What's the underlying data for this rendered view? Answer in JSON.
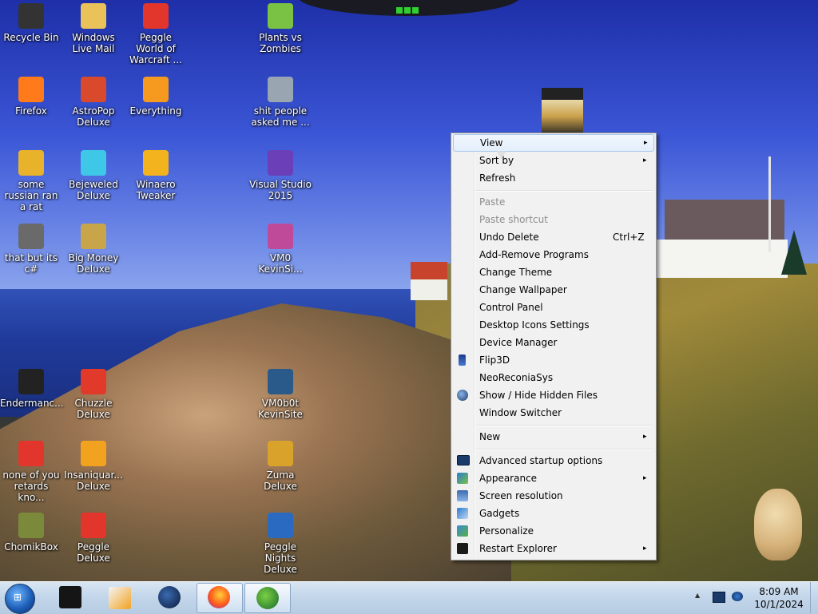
{
  "desktop_icons": [
    {
      "label": "Recycle Bin",
      "icon": "recycle-bin-icon",
      "color": "#333333"
    },
    {
      "label": "Windows Live Mail",
      "icon": "mail-icon",
      "color": "#e9c25a"
    },
    {
      "label": "Peggle World of Warcraft ...",
      "icon": "peggle-icon",
      "color": "#e2352b"
    },
    {
      "label": "Plants vs Zombies",
      "icon": "plants-icon",
      "color": "#7ac244"
    },
    {
      "label": "Firefox",
      "icon": "firefox-icon",
      "color": "#ff7a1a"
    },
    {
      "label": "AstroPop Deluxe",
      "icon": "astropop-icon",
      "color": "#d94a2c"
    },
    {
      "label": "Everything",
      "icon": "magnifier-icon",
      "color": "#f59a1e"
    },
    {
      "label": "shit people asked me ...",
      "icon": "file-icon",
      "color": "#9aa5b2"
    },
    {
      "label": "some russian ran a rat",
      "icon": "de-icon",
      "color": "#e8b22a"
    },
    {
      "label": "Bejeweled Deluxe",
      "icon": "gem-icon",
      "color": "#3fc7e8"
    },
    {
      "label": "Winaero Tweaker",
      "icon": "winaero-icon",
      "color": "#f2b31e"
    },
    {
      "label": "Visual Studio 2015",
      "icon": "visual-studio-icon",
      "color": "#6a3fb8"
    },
    {
      "label": "that but its c#",
      "icon": "stack-icon",
      "color": "#6a6a6a"
    },
    {
      "label": "Big Money Deluxe",
      "icon": "money-bag-icon",
      "color": "#c9a54a"
    },
    {
      "label": "VM0 KevinSi...",
      "icon": "vm-icon",
      "color": "#c04a9a"
    },
    {
      "label": "Endermanc...",
      "icon": "terminal-icon",
      "color": "#222222"
    },
    {
      "label": "Chuzzle Deluxe",
      "icon": "chuzzle-icon",
      "color": "#e23a2a"
    },
    {
      "label": "VM0b0t KevinSite",
      "icon": "vm-bot-icon",
      "color": "#2a5a8a"
    },
    {
      "label": "none of you retards kno...",
      "icon": "red-app-icon",
      "color": "#e2352b"
    },
    {
      "label": "Insaniquar... Deluxe",
      "icon": "insaniquarium-icon",
      "color": "#f2a21e"
    },
    {
      "label": "Zuma Deluxe",
      "icon": "zuma-icon",
      "color": "#d9a22a"
    },
    {
      "label": "ChomikBox",
      "icon": "chomik-icon",
      "color": "#7a8a3a"
    },
    {
      "label": "Peggle Deluxe",
      "icon": "peggle-icon",
      "color": "#e2352b"
    },
    {
      "label": "Peggle Nights Deluxe",
      "icon": "peggle-nights-icon",
      "color": "#2a6ac0"
    }
  ],
  "context_menu": {
    "view": "View",
    "sort_by": "Sort by",
    "refresh": "Refresh",
    "paste": "Paste",
    "paste_shortcut": "Paste shortcut",
    "undo_delete": "Undo Delete",
    "undo_delete_shortcut": "Ctrl+Z",
    "add_remove_programs": "Add-Remove Programs",
    "change_theme": "Change Theme",
    "change_wallpaper": "Change Wallpaper",
    "control_panel": "Control Panel",
    "desktop_icons_settings": "Desktop Icons Settings",
    "device_manager": "Device Manager",
    "flip3d": "Flip3D",
    "neoreconiasys": "NeoReconiaSys",
    "show_hide_hidden_files": "Show / Hide Hidden Files",
    "window_switcher": "Window Switcher",
    "new": "New",
    "advanced_startup_options": "Advanced startup options",
    "appearance": "Appearance",
    "screen_resolution": "Screen resolution",
    "gadgets": "Gadgets",
    "personalize": "Personalize",
    "restart_explorer": "Restart Explorer",
    "arrow": "▸"
  },
  "taskbar": {
    "time": "8:09 AM",
    "date": "10/1/2024",
    "tray_up_arrow": "▲",
    "start_glyph": "⊞"
  },
  "colors": {
    "accent": "#3a7bd5",
    "menu_bg": "#f1f1f1",
    "highlight_border": "#a8c8ec"
  }
}
